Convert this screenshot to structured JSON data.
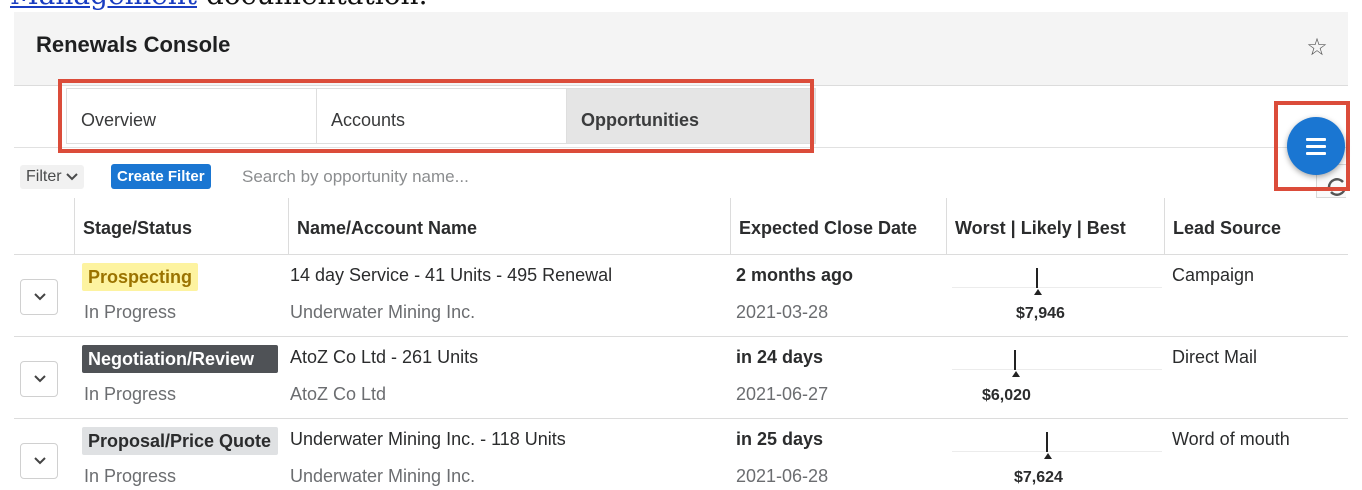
{
  "doc_snippet": {
    "link_text": "Management",
    "rest_text": " documentation."
  },
  "header": {
    "title": "Renewals Console"
  },
  "tabs": [
    {
      "label": "Overview",
      "active": false
    },
    {
      "label": "Accounts",
      "active": false
    },
    {
      "label": "Opportunities",
      "active": true
    }
  ],
  "filter_bar": {
    "filter_label": "Filter",
    "create_filter_label": "Create Filter",
    "search_placeholder": "Search by opportunity name..."
  },
  "table": {
    "columns": [
      "Stage/Status",
      "Name/Account Name",
      "Expected Close Date",
      "Worst | Likely | Best",
      "Lead Source"
    ],
    "rows": [
      {
        "stage": "Prospecting",
        "stage_style": "highlight-yellow",
        "status": "In Progress",
        "name": "14 day Service - 41 Units - 495 Renewal",
        "account": "Underwater Mining Inc.",
        "close_relative": "2 months ago",
        "close_date": "2021-03-28",
        "likely": "$7,946",
        "lead_source": "Campaign"
      },
      {
        "stage": "Negotiation/Review",
        "stage_style": "dark",
        "status": "In Progress",
        "name": "AtoZ Co Ltd - 261 Units",
        "account": "AtoZ Co Ltd",
        "close_relative": "in 24 days",
        "close_date": "2021-06-27",
        "likely": "$6,020",
        "lead_source": "Direct Mail"
      },
      {
        "stage": "Proposal/Price Quote",
        "stage_style": "light-gray",
        "status": "In Progress",
        "name": "Underwater Mining Inc. - 118 Units",
        "account": "Underwater Mining Inc.",
        "close_relative": "in 25 days",
        "close_date": "2021-06-28",
        "likely": "$7,624",
        "lead_source": "Word of mouth"
      }
    ]
  },
  "colors": {
    "accent": "#1a76d2",
    "callout": "#db4c3a",
    "stage_yellow": "#fdf3a0",
    "stage_dark": "#4f5256",
    "stage_gray": "#dfe1e3"
  },
  "icons": {
    "favorite": "star-icon",
    "menu": "hamburger-icon",
    "expand": "chevron-down-icon",
    "refresh": "refresh-icon"
  }
}
